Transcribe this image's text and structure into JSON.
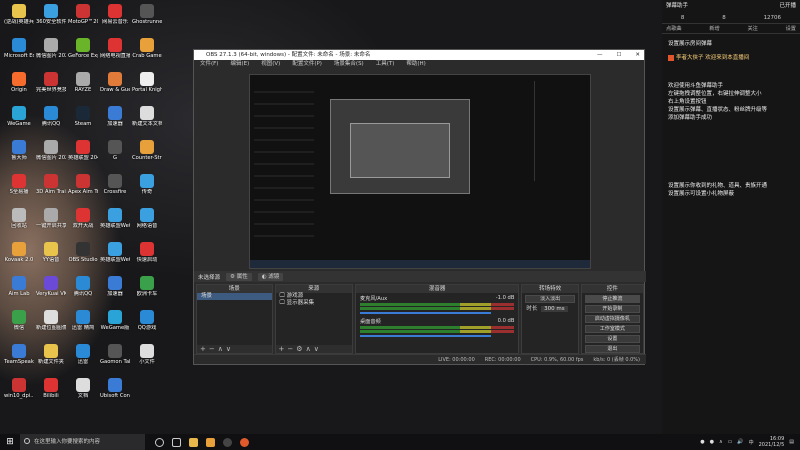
{
  "desktop_icons": [
    {
      "label": "(逆战)英雄兵",
      "color": "#e8c44c"
    },
    {
      "label": "360安全软件",
      "color": "#3aa0e0"
    },
    {
      "label": "MotoGP™20",
      "color": "#c33"
    },
    {
      "label": "网易云音乐",
      "color": "#d33"
    },
    {
      "label": "Ghostrunner - 幽灵行者",
      "color": "#555"
    },
    {
      "label": "Microsoft Edge",
      "color": "#2a8ad6"
    },
    {
      "label": "微信图片 2021100...",
      "color": "#aaa"
    },
    {
      "label": "GeForce Experience",
      "color": "#6ab42a"
    },
    {
      "label": "网络电视直播",
      "color": "#d33"
    },
    {
      "label": "Crab Game",
      "color": "#e8a03a"
    },
    {
      "label": "Origin",
      "color": "#f56c2d"
    },
    {
      "label": "完美世界竞技平台",
      "color": "#c33"
    },
    {
      "label": "RAYZE",
      "color": "#aaa"
    },
    {
      "label": "Draw & Guess",
      "color": "#e07b39"
    },
    {
      "label": "Portal Knights",
      "color": "#eee"
    },
    {
      "label": "WeGame",
      "color": "#2aa4d6"
    },
    {
      "label": "腾讯QQ",
      "color": "#2a8ad6"
    },
    {
      "label": "Steam",
      "color": "#1b2838"
    },
    {
      "label": "加速器",
      "color": "#3a7bd5"
    },
    {
      "label": "新建文本文档",
      "color": "#ddd"
    },
    {
      "label": "鲁大师",
      "color": "#3a7bd5"
    },
    {
      "label": "微信图片 2021100...",
      "color": "#aaa"
    },
    {
      "label": "英雄联盟 2042",
      "color": "#d33"
    },
    {
      "label": "G",
      "color": "#555"
    },
    {
      "label": "Counter-Strike",
      "color": "#e8a03a"
    },
    {
      "label": "S全易播",
      "color": "#d33"
    },
    {
      "label": "3D Aim Trainer",
      "color": "#c33"
    },
    {
      "label": "Apex Aim Trainer",
      "color": "#c33"
    },
    {
      "label": "Crossfire",
      "color": "#555"
    },
    {
      "label": "传奇",
      "color": "#3aa0e0"
    },
    {
      "label": "回收站",
      "color": "#bbb"
    },
    {
      "label": "一键开启共享 Windows ...",
      "color": "#aaa"
    },
    {
      "label": "双开大战",
      "color": "#d33"
    },
    {
      "label": "英雄联盟WeGame版",
      "color": "#3aa0e0"
    },
    {
      "label": "网络语音",
      "color": "#3aa0e0"
    },
    {
      "label": "Kovaak 2.0",
      "color": "#e8a03a"
    },
    {
      "label": "YY语音",
      "color": "#e8c44c"
    },
    {
      "label": "OBS Studio",
      "color": "#333"
    },
    {
      "label": "英雄联盟WeGame版",
      "color": "#3aa0e0"
    },
    {
      "label": "快速启动",
      "color": "#d33"
    },
    {
      "label": "Aim Lab",
      "color": "#3a7bd5"
    },
    {
      "label": "VeryKuai VK 加速器",
      "color": "#6a4ad6"
    },
    {
      "label": "腾讯QQ",
      "color": "#2a8ad6"
    },
    {
      "label": "加速器",
      "color": "#3a7bd5"
    },
    {
      "label": "欧洲卡车",
      "color": "#3aa04a"
    },
    {
      "label": "微信",
      "color": "#3aa04a"
    },
    {
      "label": "新建位图图像",
      "color": "#ddd"
    },
    {
      "label": "迅雷 精简",
      "color": "#2a8ad6"
    },
    {
      "label": "WeGame版",
      "color": "#2aa4d6"
    },
    {
      "label": "QQ游戏",
      "color": "#2a8ad6"
    },
    {
      "label": "TeamSpeak",
      "color": "#3a7bd5"
    },
    {
      "label": "新建文件夹",
      "color": "#e8c44c"
    },
    {
      "label": "迅雷",
      "color": "#2a8ad6"
    },
    {
      "label": "Gaomon Tablet",
      "color": "#555"
    },
    {
      "label": "小文件",
      "color": "#ddd"
    },
    {
      "label": "win10_dpi...",
      "color": "#c33"
    },
    {
      "label": "Bilibili",
      "color": "#d33"
    },
    {
      "label": "文档",
      "color": "#ddd"
    },
    {
      "label": "Ubisoft Connect",
      "color": "#3a7bd5"
    }
  ],
  "obs": {
    "title": "OBS 27.1.3 (64-bit, windows) - 配置文件: 未命名 - 场景: 未命名",
    "menu": [
      "文件(F)",
      "编辑(E)",
      "视图(V)",
      "配置文件(P)",
      "场景集合(S)",
      "工具(T)",
      "帮助(H)"
    ],
    "scene_bar": {
      "label": "未选择源",
      "btn1": "属性",
      "btn2": "滤镜"
    },
    "docks": {
      "scenes": {
        "title": "场景",
        "items": [
          "场景"
        ]
      },
      "sources": {
        "title": "来源",
        "items": [
          "游戏源",
          "显示器采集"
        ]
      },
      "mixer": {
        "title": "混音器",
        "tracks": [
          {
            "name": "麦克风/Aux",
            "db": "-1.0 dB"
          },
          {
            "name": "桌面音频",
            "db": "0.0 dB"
          }
        ]
      },
      "transitions": {
        "title": "转场特效",
        "type": "淡入淡出",
        "duration_label": "时长",
        "duration": "300 ms"
      },
      "controls": {
        "title": "控件",
        "buttons": [
          "停止推流",
          "开始录制",
          "启动虚拟摄像机",
          "工作室模式",
          "设置",
          "退出"
        ]
      }
    },
    "status": {
      "live": "LIVE: 00:00:00",
      "rec": "REC: 00:00:00",
      "cpu": "CPU: 0.9%, 60.00 fps",
      "kbps": "kb/s: 0 (丢帧 0.0%)"
    }
  },
  "right_panel": {
    "title": "弹幕助手",
    "status": "已开播",
    "stats": [
      "8",
      "8",
      "12706"
    ],
    "tabs": [
      "点歌曲",
      "新增",
      "关注",
      "设置"
    ],
    "messages": [
      {
        "text": "设置展示房间弹幕",
        "type": "info"
      },
      {
        "text": "李者大侠子  欢迎来到本直播间",
        "type": "warn"
      },
      {
        "text": "欢迎使用斗鱼弹幕助手",
        "type": "info"
      },
      {
        "text": "左键拖拽调整位置，右键拉伸调整大小",
        "type": "info"
      },
      {
        "text": "右上角设置按钮",
        "type": "info"
      },
      {
        "text": "设置展示弹幕、直播状态、粉丝牌升级等",
        "type": "info"
      },
      {
        "text": "添加弹幕助手成功",
        "type": "info"
      },
      {
        "text": "设置展示你收到的礼物、道具、贵族开通",
        "type": "info"
      },
      {
        "text": "设置展示可设置小礼物屏蔽",
        "type": "info"
      }
    ]
  },
  "taskbar": {
    "search_placeholder": "在这里输入你要搜索的内容",
    "time": "16:09",
    "date": "2021/12/5"
  }
}
